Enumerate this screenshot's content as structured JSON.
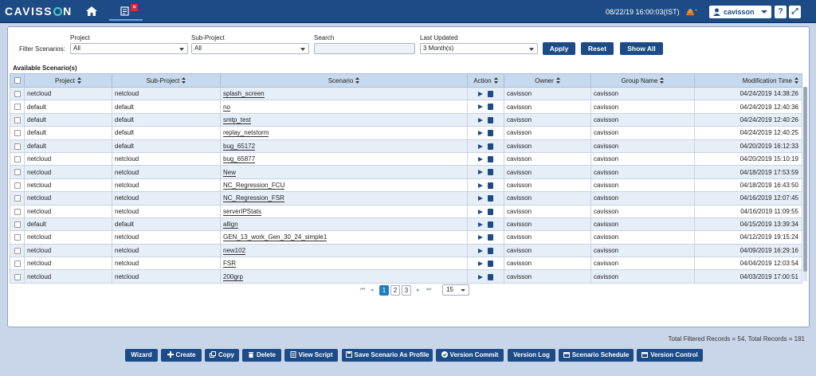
{
  "app": {
    "logo": "CAVISSON",
    "datetime": "08/22/19 16:00:03(IST)",
    "user": "cavisson",
    "help_glyph": "?",
    "expand_glyph": "⤢",
    "icons": [
      "home-icon",
      "scenario-tab-icon",
      "close-icon",
      "alert-icon",
      "user-icon",
      "chevron-down-icon",
      "help-icon",
      "expand-icon"
    ],
    "colors": {
      "accent": "#1d4b86",
      "page_bg": "#c9d6ea",
      "active_page": "#1d7fc0"
    }
  },
  "filters": {
    "label": "Filter Scenarios:",
    "project": {
      "label": "Project",
      "value": "All"
    },
    "subproject": {
      "label": "Sub-Project",
      "value": "All"
    },
    "search": {
      "label": "Search",
      "value": ""
    },
    "last_updated": {
      "label": "Last Updated",
      "value": "3 Month(s)"
    },
    "apply": "Apply",
    "reset": "Reset",
    "show_all": "Show All"
  },
  "section_title": "Available Scenario(s)",
  "table": {
    "headers": {
      "project": "Project",
      "subproject": "Sub-Project",
      "scenario": "Scenario",
      "action": "Action",
      "owner": "Owner",
      "group": "Group Name",
      "modified": "Modification Time"
    },
    "rows": [
      {
        "project": "netcloud",
        "subproject": "netcloud",
        "scenario": "splash_screen",
        "owner": "cavisson",
        "group": "cavisson",
        "modified": "04/24/2019 14:38:26"
      },
      {
        "project": "default",
        "subproject": "default",
        "scenario": "no",
        "owner": "cavisson",
        "group": "cavisson",
        "modified": "04/24/2019 12:40:36"
      },
      {
        "project": "default",
        "subproject": "default",
        "scenario": "smtp_test",
        "owner": "cavisson",
        "group": "cavisson",
        "modified": "04/24/2019 12:40:26"
      },
      {
        "project": "default",
        "subproject": "default",
        "scenario": "replay_netstorm",
        "owner": "cavisson",
        "group": "cavisson",
        "modified": "04/24/2019 12:40:25"
      },
      {
        "project": "default",
        "subproject": "default",
        "scenario": "bug_65172",
        "owner": "cavisson",
        "group": "cavisson",
        "modified": "04/20/2019 16:12:33"
      },
      {
        "project": "netcloud",
        "subproject": "netcloud",
        "scenario": "bug_65877",
        "owner": "cavisson",
        "group": "cavisson",
        "modified": "04/20/2019 15:10:19"
      },
      {
        "project": "netcloud",
        "subproject": "netcloud",
        "scenario": "New",
        "owner": "cavisson",
        "group": "cavisson",
        "modified": "04/18/2019 17:53:59"
      },
      {
        "project": "netcloud",
        "subproject": "netcloud",
        "scenario": "NC_Regression_FCU",
        "owner": "cavisson",
        "group": "cavisson",
        "modified": "04/18/2019 16:43:50"
      },
      {
        "project": "netcloud",
        "subproject": "netcloud",
        "scenario": "NC_Regression_FSR",
        "owner": "cavisson",
        "group": "cavisson",
        "modified": "04/16/2019 12:07:45"
      },
      {
        "project": "netcloud",
        "subproject": "netcloud",
        "scenario": "serverIPStats",
        "owner": "cavisson",
        "group": "cavisson",
        "modified": "04/16/2019 11:09:55"
      },
      {
        "project": "default",
        "subproject": "default",
        "scenario": "allign",
        "owner": "cavisson",
        "group": "cavisson",
        "modified": "04/15/2019 13:39:34"
      },
      {
        "project": "netcloud",
        "subproject": "netcloud",
        "scenario": "GEN_13_work_Gen_30_24_simple1",
        "owner": "cavisson",
        "group": "cavisson",
        "modified": "04/12/2019 19:15:24"
      },
      {
        "project": "netcloud",
        "subproject": "netcloud",
        "scenario": "new102",
        "owner": "cavisson",
        "group": "cavisson",
        "modified": "04/09/2019 16:29:16"
      },
      {
        "project": "netcloud",
        "subproject": "netcloud",
        "scenario": "FSR",
        "owner": "cavisson",
        "group": "cavisson",
        "modified": "04/04/2019 12:03:54"
      },
      {
        "project": "netcloud",
        "subproject": "netcloud",
        "scenario": "200grp",
        "owner": "cavisson",
        "group": "cavisson",
        "modified": "04/03/2019 17:00:51"
      }
    ]
  },
  "pagination": {
    "pages": [
      "1",
      "2",
      "3"
    ],
    "active": "1",
    "page_size": "15",
    "first": "⏮",
    "prev": "◂",
    "next": "▸",
    "last": "⏭"
  },
  "records_summary": "Total Filtered Records = 54, Total Records = 181",
  "actions": {
    "wizard": "Wizard",
    "create": "Create",
    "copy": "Copy",
    "delete": "Delete",
    "view_script": "View Script",
    "save_profile": "Save Scenario As Profile",
    "version_commit": "Version Commit",
    "version_log": "Version Log",
    "scenario_schedule": "Scenario Schedule",
    "version_control": "Version Control"
  }
}
